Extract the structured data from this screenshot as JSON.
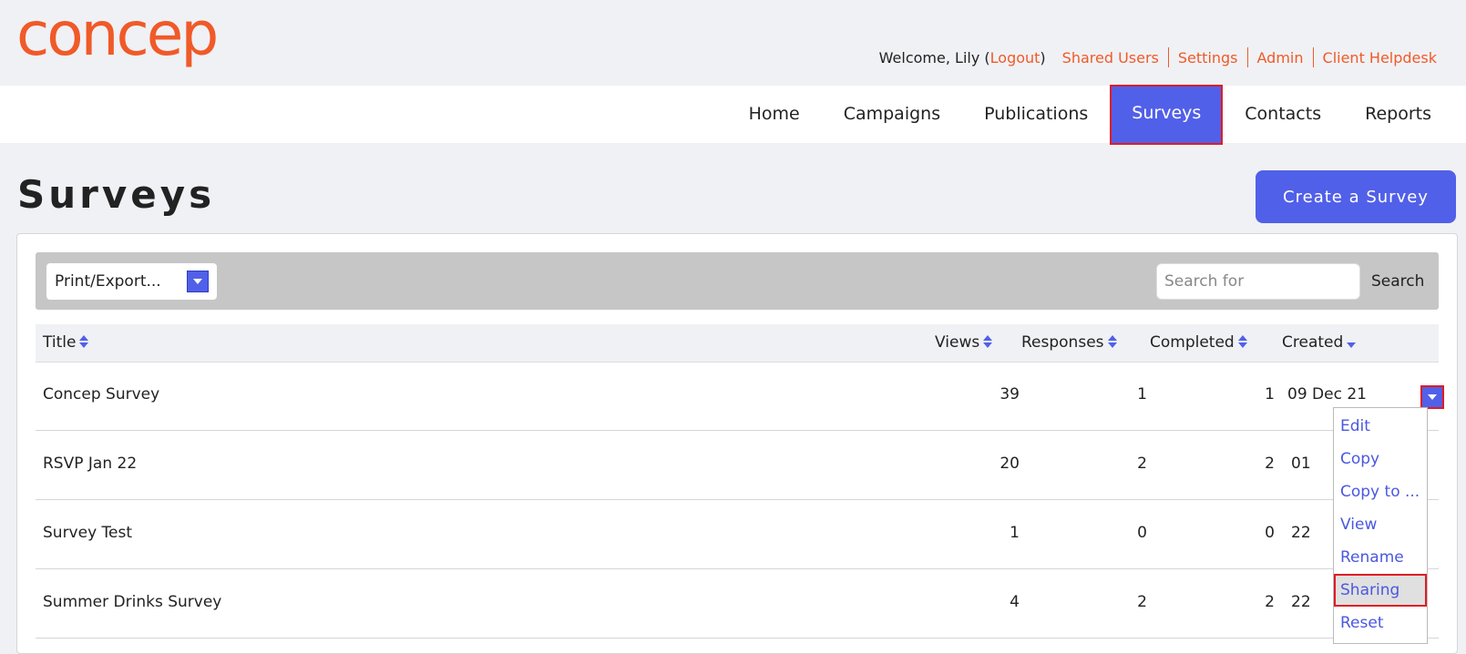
{
  "brand": {
    "logo_text": "concep",
    "color": "#f05a28"
  },
  "header": {
    "welcome_prefix": "Welcome, Lily (",
    "logout": "Logout",
    "welcome_suffix": ")",
    "links": [
      "Shared Users",
      "Settings",
      "Admin",
      "Client Helpdesk"
    ]
  },
  "nav": {
    "items": [
      "Home",
      "Campaigns",
      "Publications",
      "Surveys",
      "Contacts",
      "Reports"
    ],
    "active": "Surveys"
  },
  "page": {
    "title": "Surveys",
    "create_button": "Create a Survey"
  },
  "toolbar": {
    "export_label": "Print/Export...",
    "search_placeholder": "Search for",
    "search_button": "Search"
  },
  "table": {
    "columns": {
      "title": "Title",
      "views": "Views",
      "responses": "Responses",
      "completed": "Completed",
      "created": "Created"
    },
    "rows": [
      {
        "title": "Concep Survey",
        "views": "39",
        "responses": "1",
        "completed": "1",
        "created": "09 Dec 21"
      },
      {
        "title": "RSVP Jan 22",
        "views": "20",
        "responses": "2",
        "completed": "2",
        "created": "01"
      },
      {
        "title": "Survey Test",
        "views": "1",
        "responses": "0",
        "completed": "0",
        "created": "22"
      },
      {
        "title": "Summer Drinks Survey",
        "views": "4",
        "responses": "2",
        "completed": "2",
        "created": "22"
      }
    ]
  },
  "row_menu": {
    "items": [
      "Edit",
      "Copy",
      "Copy to ...",
      "View",
      "Rename",
      "Sharing",
      "Reset"
    ],
    "highlighted": "Sharing"
  },
  "colors": {
    "accent": "#5160e8",
    "brand_orange": "#f05a28",
    "highlight_border": "#e01b24",
    "link_blue": "#4a58e0"
  }
}
